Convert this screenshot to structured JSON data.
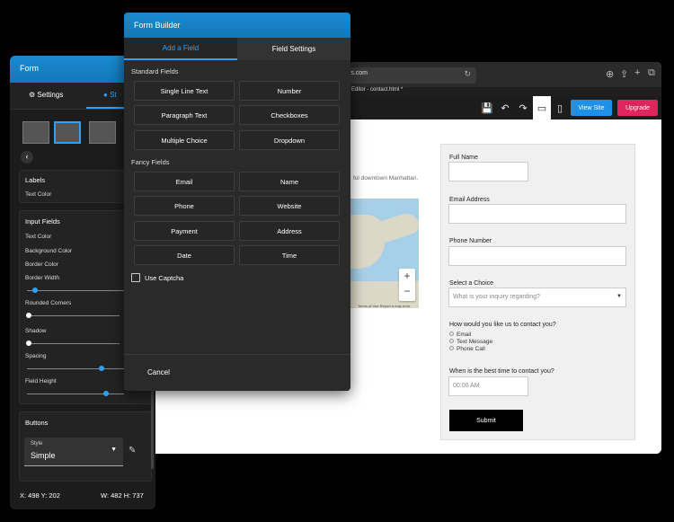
{
  "browser": {
    "url": "rs.com",
    "tab_title": "ite Editor - contact.html *",
    "toolbar": {
      "view_site": "View Site",
      "upgrade": "Upgrade"
    }
  },
  "page": {
    "body_text": "ful downtown Manhattan.",
    "map_credits": "Terms of Use   Report a map error",
    "form": {
      "full_name_label": "Full Name",
      "email_label": "Email Address",
      "phone_label": "Phone Number",
      "choice_label": "Select a Choice",
      "choice_placeholder": "What is your inquiry regarding?",
      "contact_label": "How would you like us to contact you?",
      "contact_options": [
        "Email",
        "Text Message",
        "Phone Call"
      ],
      "time_label": "When is the best time to contact you?",
      "time_placeholder": "00:00 AM",
      "submit_label": "Submit"
    }
  },
  "form_panel": {
    "title": "Form",
    "tab_settings": "Settings",
    "tab_style": "St",
    "labels_section": {
      "title": "Labels",
      "text_color": "Text Color"
    },
    "input_fields_section": {
      "title": "Input Fields",
      "items": [
        "Text Color",
        "Background Color",
        "Border Color",
        "Border Width"
      ],
      "rounded_corners": "Rounded Corners",
      "shadow": "Shadow",
      "spacing": "Spacing",
      "field_height": "Field Height"
    },
    "buttons_section": {
      "title": "Buttons",
      "style_label": "Style",
      "style_value": "Simple"
    },
    "coords": "X: 498 Y: 202",
    "size": "W: 482 H: 737"
  },
  "builder": {
    "title": "Form Builder",
    "tab_add": "Add a Field",
    "tab_settings": "Field Settings",
    "standard_label": "Standard Fields",
    "standard_fields": [
      "Single Line Text",
      "Number",
      "Paragraph Text",
      "Checkboxes",
      "Multiple Choice",
      "Dropdown"
    ],
    "fancy_label": "Fancy Fields",
    "fancy_fields": [
      "Email",
      "Name",
      "Phone",
      "Website",
      "Payment",
      "Address",
      "Date",
      "Time"
    ],
    "captcha_label": "Use Captcha",
    "cancel_label": "Cancel"
  },
  "colors": {
    "accent": "#1e90e8",
    "upgrade": "#e0245e"
  }
}
